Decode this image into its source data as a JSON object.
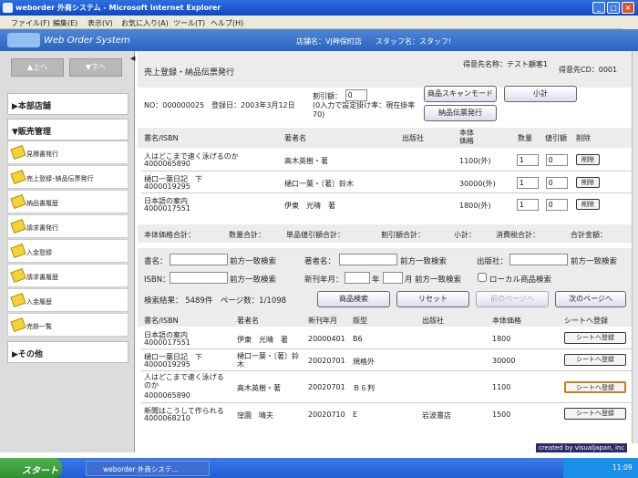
{
  "window": {
    "title": "weborder 外商システム - Microsoft Internet Explorer"
  },
  "menu": [
    "ファイル(F)",
    "編集(E)",
    "表示(V)",
    "お気に入り(A)",
    "ツール(T)",
    "ヘルプ(H)"
  ],
  "app": {
    "title": "Web Order System",
    "store": "店舗名：VJ神保町店",
    "staff": "スタッフ名：スタッフ!"
  },
  "sidebar": {
    "up": "上へ",
    "down": "下へ",
    "sections": [
      "本部店舗",
      "販売管理",
      "その他"
    ],
    "items": [
      "見積書発行",
      "売上登録･納品伝票発行",
      "納品書履歴",
      "請求書発行",
      "入金登録",
      "請求書履歴",
      "入金履歴",
      "売掛一覧"
    ]
  },
  "page": {
    "title": "売上登録・納品伝票発行",
    "customer_name": "得意先名称：テスト顧客1",
    "customer_cd": "得意先CD：0001",
    "no": "NO：000000025",
    "date": "登録日：2003年3月12日",
    "discount_label": "割引額：",
    "discount_value": "0",
    "discount_note": "(0入力で設定掛け率：現在掛率70)",
    "scan_button": "商品スキャンモード",
    "subtotal_button": "小計",
    "slip_button": "納品伝票発行"
  },
  "cart": {
    "headers": [
      "書名/ISBN",
      "著者名",
      "出版社",
      "本体価格",
      "数量",
      "値引額",
      "削除"
    ],
    "rows": [
      {
        "title": "人はどこまで速く泳げるのか",
        "isbn": "4000065890",
        "author": "高木英樹・著",
        "publisher": "",
        "price": "1100(外)",
        "qty": "1",
        "discount": "0",
        "delete": "削除"
      },
      {
        "title": "樋口一葉日記　下",
        "isbn": "4000019295",
        "author": "樋口一葉・〔著〕鈴木",
        "publisher": "",
        "price": "30000(外)",
        "qty": "1",
        "discount": "0",
        "delete": "削除"
      },
      {
        "title": "日本語の案内",
        "isbn": "4000017551",
        "author": "伊東　光晴　著",
        "publisher": "",
        "price": "1800(外)",
        "qty": "1",
        "discount": "0",
        "delete": "削除"
      }
    ]
  },
  "totals": [
    "本体価格合計：",
    "数量合計：",
    "単品値引額合計：",
    "割引額合計：",
    "小計：",
    "消費税合計：",
    "合計金額："
  ],
  "search": {
    "title_label": "書名：",
    "match1": "前方一致検索",
    "author_label": "著者名：",
    "match2": "前方一致検索",
    "publisher_label": "出版社：",
    "match3": "前方一致検索",
    "isbn_label": "ISBN：",
    "match4": "前方一致検索",
    "date_label": "新刊年月：",
    "year": "年",
    "month": "月",
    "match5": "前方一致検索",
    "local_label": "ローカル商品検索",
    "result": "検索結果： 5489件　ページ数：1/1098",
    "search_button": "商品検索",
    "reset_button": "リセット",
    "prev_button": "前のページへ",
    "next_button": "次のページへ"
  },
  "results": {
    "headers": [
      "書名/ISBN",
      "著者名",
      "新刊年月",
      "版型",
      "出版社",
      "本体価格",
      "シートへ登録"
    ],
    "rows": [
      {
        "title": "日本語の案内",
        "isbn": "4000017551",
        "author": "伊東　光晴　著",
        "date": "20000401",
        "format": "B6",
        "publisher": "",
        "price": "1800",
        "button": "シートへ登録"
      },
      {
        "title": "樋口一葉日記　下",
        "isbn": "4000019295",
        "author": "樋口一葉・〔著〕鈴木",
        "date": "20020701",
        "format": "規格外",
        "publisher": "",
        "price": "30000",
        "button": "シートへ登録"
      },
      {
        "title": "人はどこまで速く泳げるのか",
        "isbn": "4000065890",
        "author": "高木英樹・著",
        "date": "20020701",
        "format": "Ｂ６判",
        "publisher": "",
        "price": "1100",
        "button": "シートへ登録"
      },
      {
        "title": "新聞はこうして作られる",
        "isbn": "4000068210",
        "author": "窪園　晴夫",
        "date": "20020710",
        "format": "E",
        "publisher": "岩波書店",
        "price": "1500",
        "button": "シートへ登録"
      }
    ]
  },
  "credit": "created by visualjapan, inc",
  "taskbar": {
    "start": "スタート",
    "task": "weborder 外商システ...",
    "time": "11:09"
  }
}
